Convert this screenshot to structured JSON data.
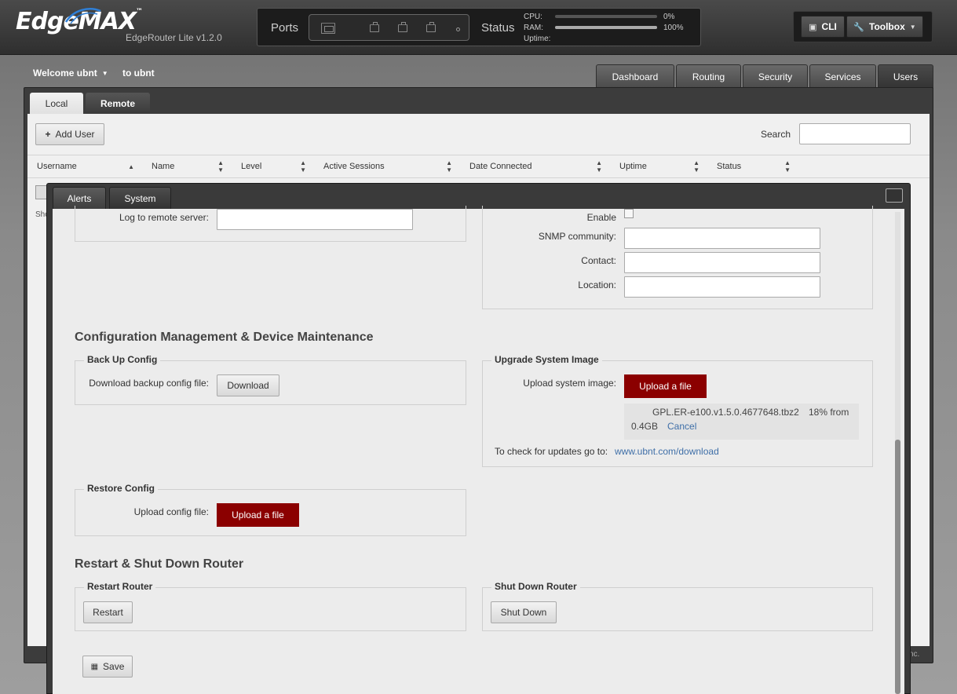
{
  "header": {
    "logo": "EdgeMAX",
    "logo_tm": "™",
    "model": "EdgeRouter Lite v1.2.0",
    "ports_label": "Ports",
    "status_label": "Status",
    "cpu_label": "CPU:",
    "cpu_value": "0%",
    "cpu_fraction": 0,
    "ram_label": "RAM:",
    "ram_value": "100%",
    "ram_fraction": 1,
    "uptime_label": "Uptime:",
    "cli_label": "CLI",
    "toolbox_label": "Toolbox"
  },
  "session": {
    "welcome": "Welcome ubnt",
    "to_user": "to ubnt"
  },
  "nav": {
    "tabs": [
      "Dashboard",
      "Routing",
      "Security",
      "Services",
      "Users"
    ],
    "active": "Users"
  },
  "users": {
    "subtabs": [
      "Local",
      "Remote"
    ],
    "add_user": "Add User",
    "search_label": "Search",
    "columns": [
      "Username",
      "Name",
      "Level",
      "Active Sessions",
      "Date Connected",
      "Uptime",
      "Status"
    ],
    "row_hint": "Sho",
    "footer": "nc."
  },
  "dialog": {
    "tabs": [
      "Alerts",
      "System"
    ],
    "active_tab": "System",
    "remote_log_label": "Log to remote server:",
    "snmp": {
      "enable_label": "Enable",
      "community_label": "SNMP community:",
      "contact_label": "Contact:",
      "location_label": "Location:"
    },
    "config_section_title": "Configuration Management & Device Maintenance",
    "backup": {
      "legend": "Back Up Config",
      "label": "Download backup config file:",
      "button": "Download"
    },
    "upgrade": {
      "legend": "Upgrade System Image",
      "label": "Upload system image:",
      "button": "Upload a file",
      "file_name": "GPL.ER-e100.v1.5.0.4677648.tbz2",
      "progress": "18% from",
      "size": "0.4GB",
      "cancel": "Cancel",
      "updates_text": "To check for updates go to:",
      "updates_link": "www.ubnt.com/download"
    },
    "restore": {
      "legend": "Restore Config",
      "label": "Upload config file:",
      "button": "Upload a file"
    },
    "restart_section_title": "Restart & Shut Down Router",
    "restart": {
      "legend": "Restart Router",
      "button": "Restart"
    },
    "shutdown": {
      "legend": "Shut Down Router",
      "button": "Shut Down"
    },
    "save_label": "Save"
  },
  "colors": {
    "accent_red": "#8b0000",
    "link_blue": "#3f6fa8"
  }
}
